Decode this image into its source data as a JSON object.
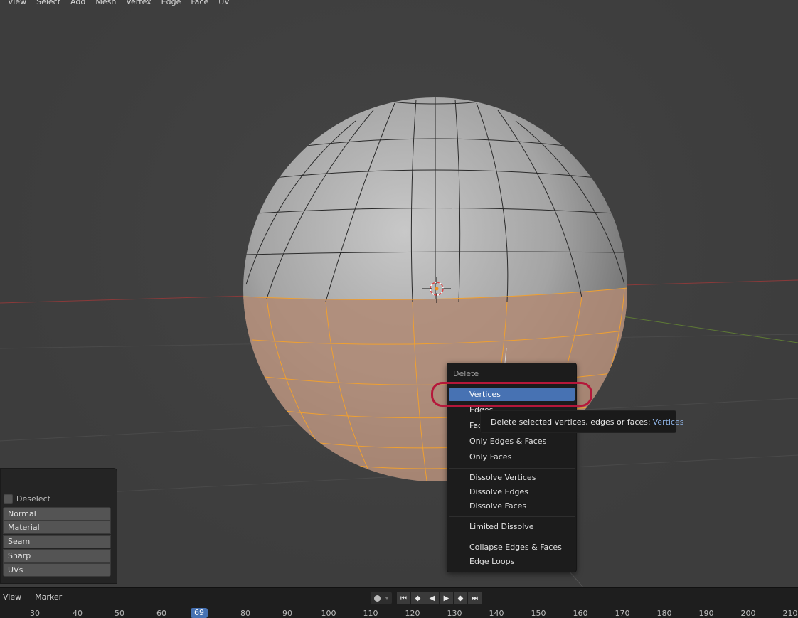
{
  "header_menu": [
    "View",
    "Select",
    "Add",
    "Mesh",
    "Vertex",
    "Edge",
    "Face",
    "UV"
  ],
  "colors": {
    "accent": "#4772b3",
    "selection": "#f0a030",
    "highlight_ring": "#b5173a"
  },
  "delete_menu": {
    "title": "Delete",
    "items": [
      {
        "label": "Vertices",
        "active": true
      },
      {
        "label": "Edges"
      },
      {
        "label": "Faces"
      },
      {
        "label": "Only Edges & Faces"
      },
      {
        "label": "Only Faces"
      },
      {
        "label": "Dissolve Vertices"
      },
      {
        "label": "Dissolve Edges"
      },
      {
        "label": "Dissolve Faces"
      },
      {
        "label": "Limited Dissolve"
      },
      {
        "label": "Collapse Edges & Faces"
      },
      {
        "label": "Edge Loops"
      }
    ]
  },
  "tooltip": {
    "text": "Delete selected vertices, edges or faces:",
    "value": "Vertices"
  },
  "left_panel": {
    "checkbox_label": "Deselect",
    "buttons": [
      "Normal",
      "Material",
      "Seam",
      "Sharp",
      "UVs"
    ]
  },
  "timeline": {
    "menu": [
      "View",
      "Marker"
    ],
    "current_frame": "69",
    "ruler_labels": [
      "30",
      "40",
      "50",
      "60",
      "80",
      "90",
      "100",
      "110",
      "120",
      "130",
      "140",
      "150",
      "160",
      "170",
      "180",
      "190",
      "200",
      "210"
    ],
    "playback_icons": [
      "jump-start-icon",
      "prev-keyframe-icon",
      "play-reverse-icon",
      "play-icon",
      "next-keyframe-icon",
      "jump-end-icon"
    ]
  }
}
